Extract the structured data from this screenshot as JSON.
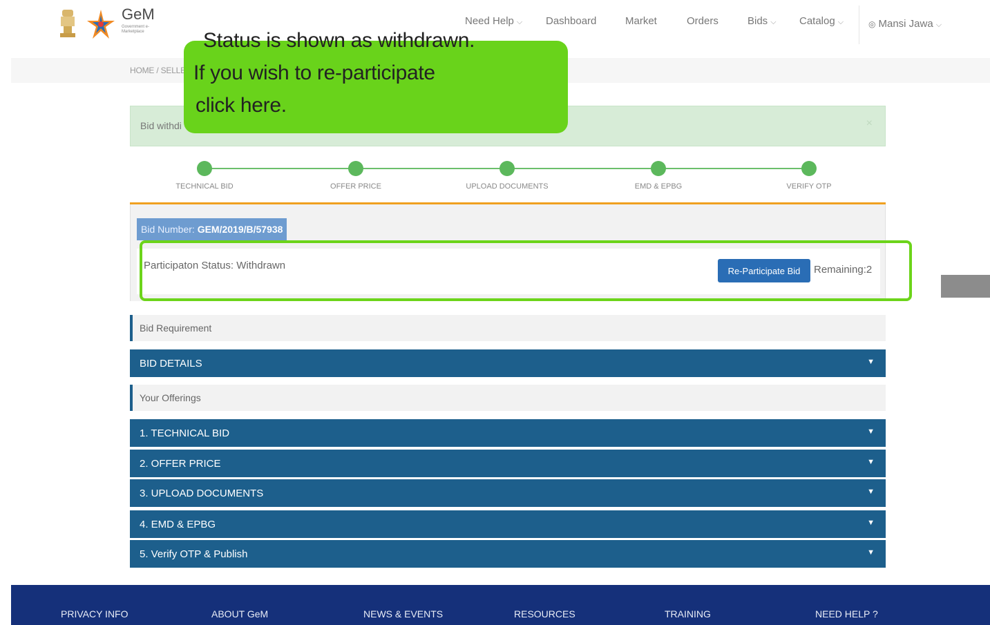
{
  "header": {
    "logo_text": "GeM",
    "logo_subtext": "Government e-Marketplace",
    "nav": [
      {
        "label": "Need Help",
        "dropdown": true
      },
      {
        "label": "Dashboard",
        "dropdown": false
      },
      {
        "label": "Market",
        "dropdown": false
      },
      {
        "label": "Orders",
        "dropdown": false
      },
      {
        "label": "Bids",
        "dropdown": true
      },
      {
        "label": "Catalog",
        "dropdown": true
      }
    ],
    "user": "Mansi Jawa"
  },
  "breadcrumb": "HOME / SELLER",
  "alert": {
    "text": "Bid withdi",
    "close": "×"
  },
  "steps": [
    "TECHNICAL BID",
    "OFFER PRICE",
    "UPLOAD DOCUMENTS",
    "EMD & EPBG",
    "VERIFY OTP"
  ],
  "bid": {
    "number_label": "Bid Number:",
    "number_value": "GEM/2019/B/57938",
    "status_label": "Participaton Status:",
    "status_value": "Withdrawn",
    "reparticipate_label": "Re-Participate Bid",
    "remaining": "Remaining:2"
  },
  "sections": {
    "requirement": "Bid Requirement",
    "offerings": "Your Offerings"
  },
  "accordions": {
    "bid_details": "BID DETAILS",
    "items": [
      "1. TECHNICAL BID",
      "2. OFFER PRICE",
      "3. UPLOAD DOCUMENTS",
      "4. EMD & EPBG",
      "5. Verify OTP & Publish"
    ]
  },
  "callout": {
    "line1": "Status is shown as withdrawn.",
    "line2": "If you wish to re-participate",
    "line3": "click here."
  },
  "footer": [
    "PRIVACY INFO",
    "ABOUT GeM",
    "NEWS & EVENTS",
    "RESOURCES",
    "TRAINING",
    "NEED HELP ?"
  ],
  "colors": {
    "accordion": "#1d5f8c",
    "callout": "#69d31b",
    "footer": "#15307a",
    "button": "#2a6db5",
    "step": "#5cb85c"
  },
  "icons": {
    "emblem": "national-emblem-icon",
    "star": "gem-star-logo-icon",
    "user": "user-icon",
    "caret": "caret-down-icon"
  }
}
